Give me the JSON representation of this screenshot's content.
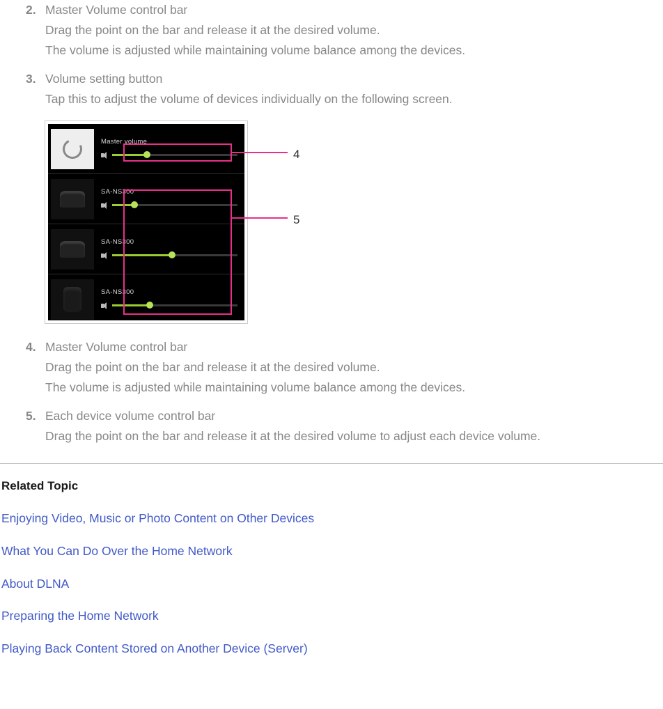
{
  "items": [
    {
      "num": "2.",
      "title": "Master Volume control bar",
      "lines": [
        "Drag the point on the bar and release it at the desired volume.",
        "The volume is adjusted while maintaining volume balance among the devices."
      ]
    },
    {
      "num": "3.",
      "title": "Volume setting button",
      "lines": [
        "Tap this to adjust the volume of devices individually on the following screen."
      ]
    },
    {
      "num": "4.",
      "title": "Master Volume control bar",
      "lines": [
        "Drag the point on the bar and release it at the desired volume.",
        "The volume is adjusted while maintaining volume balance among the devices."
      ]
    },
    {
      "num": "5.",
      "title": "Each device volume control bar",
      "lines": [
        "Drag the point on the bar and release it at the desired volume to adjust each device volume."
      ]
    }
  ],
  "diagram": {
    "rows": [
      {
        "label": "Master volume",
        "fill": 28
      },
      {
        "label": "SA-NS300",
        "fill": 18
      },
      {
        "label": "SA-NS300",
        "fill": 48
      },
      {
        "label": "SA-NS300",
        "fill": 30
      }
    ],
    "callouts": {
      "c4": "4",
      "c5": "5"
    }
  },
  "related": {
    "heading": "Related Topic",
    "links": [
      "Enjoying Video, Music or Photo Content on Other Devices",
      "What You Can Do Over the Home Network",
      "About DLNA",
      "Preparing the Home Network",
      "Playing Back Content Stored on Another Device (Server)"
    ]
  }
}
